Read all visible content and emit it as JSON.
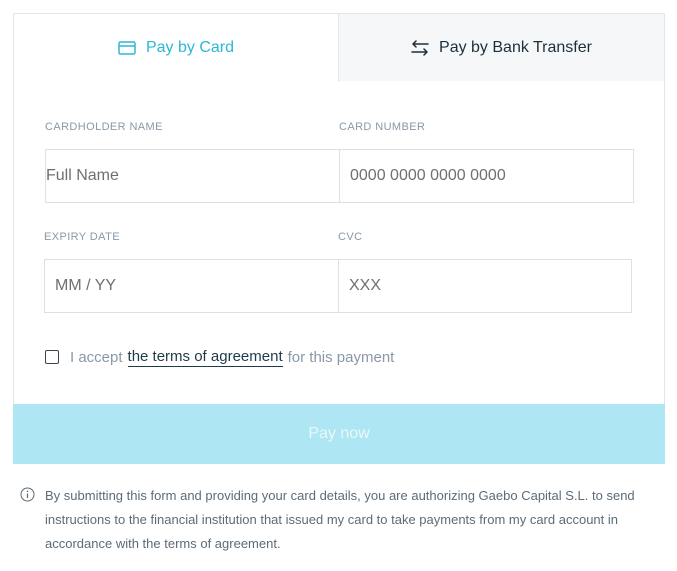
{
  "tabs": {
    "card_label": "Pay by Card",
    "bank_label": "Pay by Bank Transfer"
  },
  "form": {
    "cardholder": {
      "label": "CARDHOLDER NAME",
      "placeholder": "Full Name"
    },
    "card_number": {
      "label": "CARD NUMBER",
      "placeholder": "0000 0000 0000 0000"
    },
    "expiry": {
      "label": "EXPIRY DATE",
      "placeholder": "MM / YY"
    },
    "cvc": {
      "label": "CVC",
      "placeholder": "XXX"
    },
    "terms": {
      "prefix": "I accept",
      "link": "the terms of agreement",
      "suffix": "for this payment",
      "checked": false
    }
  },
  "submit": {
    "label": "Pay now"
  },
  "disclaimer": {
    "text": "By submitting this form and providing your card details, you are authorizing Gaebo Capital S.L. to send instructions to the financial institution that issued my card to take payments from my card account in accordance with the terms of agreement."
  },
  "colors": {
    "accent": "#2ab8d6",
    "button_disabled": "#aee6f3",
    "link": "#1f3a4a"
  },
  "icons": {
    "card_tab": "credit-card-icon",
    "bank_tab": "transfer-arrows-icon",
    "disclaimer": "info-icon"
  }
}
